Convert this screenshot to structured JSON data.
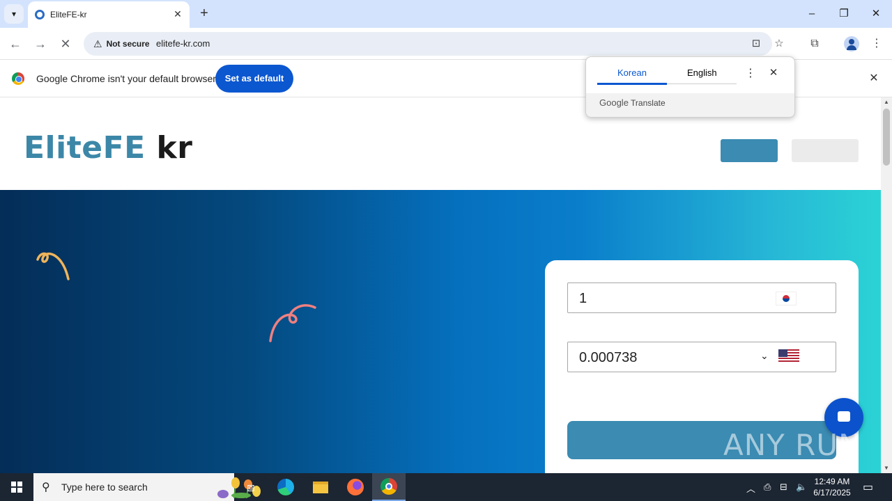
{
  "browser": {
    "tab_title": "EliteFE-kr",
    "tab_search_icon": "chevron-down-icon",
    "new_tab_label": "+",
    "window_controls": [
      "–",
      "❐",
      "✕"
    ],
    "security_label": "Not secure",
    "url": "elitefe-kr.com"
  },
  "infobar": {
    "message": "Google Chrome isn't your default browser",
    "set_default_label": "Set as default"
  },
  "translate": {
    "tabs": [
      "Korean",
      "English"
    ],
    "brand_google": "Google",
    "brand_translate": "Translate"
  },
  "site": {
    "logo_part1": "EliteFE",
    "logo_part2": "kr",
    "from_amount": "1",
    "to_amount": "0.000738",
    "colors": {
      "brand": "#3c87a8",
      "button": "#3b8bb2",
      "hero_start": "#042d58",
      "hero_end": "#2bd3d5",
      "chat": "#0b52cc"
    }
  },
  "watermark": "ANY RUN",
  "taskbar": {
    "search_placeholder": "Type here to search",
    "time": "12:49 AM",
    "date": "6/17/2025"
  }
}
